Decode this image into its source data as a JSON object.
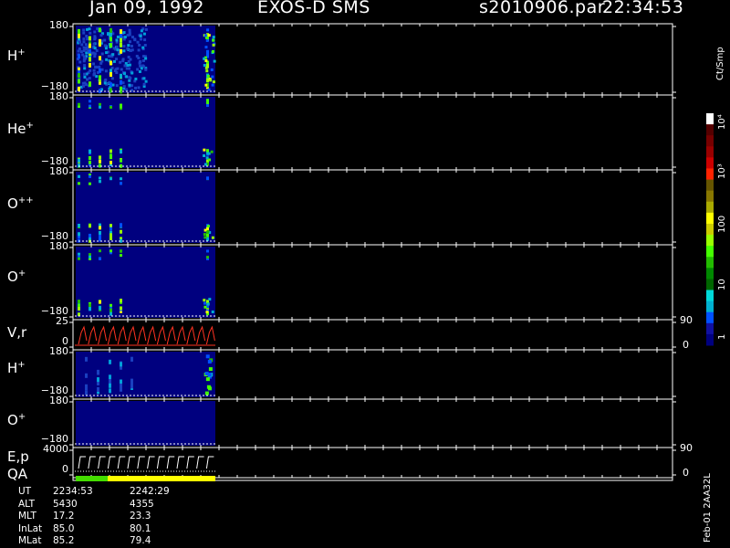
{
  "header": {
    "date": "Jan 09, 1992",
    "instrument": "EXOS-D SMS",
    "file": "s2010906.par",
    "time": "22:34:53"
  },
  "panels": [
    {
      "name": "H",
      "sup": "+",
      "top": "180",
      "bottom": "−180"
    },
    {
      "name": "He",
      "sup": "+",
      "top": "180",
      "bottom": "−180"
    },
    {
      "name": "O",
      "sup": "++",
      "top": "180",
      "bottom": "−180"
    },
    {
      "name": "O",
      "sup": "+",
      "top": "180",
      "bottom": "−180"
    },
    {
      "name": "V,r",
      "sup": "",
      "top": "25",
      "bottom": "0",
      "right_top": "90",
      "right_bottom": "0"
    },
    {
      "name": "H",
      "sup": "+",
      "top": "180",
      "bottom": "−180"
    },
    {
      "name": "O",
      "sup": "+",
      "top": "180",
      "bottom": "−180"
    },
    {
      "name": "E,p",
      "sup": "",
      "top": "4000",
      "bottom": "0",
      "right_top": "90",
      "right_bottom": "0"
    }
  ],
  "qa_label": "QA",
  "orbit": {
    "rows": [
      {
        "label": "UT",
        "v1": "2234:53",
        "v2": "2242:29"
      },
      {
        "label": "ALT",
        "v1": "5430",
        "v2": "4355"
      },
      {
        "label": "MLT",
        "v1": "17.2",
        "v2": "23.3"
      },
      {
        "label": "InLat",
        "v1": "85.0",
        "v2": "80.1"
      },
      {
        "label": "MLat",
        "v1": "85.2",
        "v2": "79.4"
      }
    ]
  },
  "colorbar": {
    "unit": "Ct/Smp",
    "labels": [
      "1",
      "10",
      "100",
      "10³",
      "10⁴"
    ],
    "colors": [
      "#00007f",
      "#1010a0",
      "#0050ff",
      "#00b0d0",
      "#00d8d8",
      "#006600",
      "#008800",
      "#22bb00",
      "#44ff00",
      "#99ff00",
      "#cccc00",
      "#ffff00",
      "#aaaa00",
      "#887700",
      "#665500",
      "#ff2200",
      "#cc0000",
      "#990000",
      "#770000",
      "#550000",
      "#ffffff"
    ],
    "colors_note": ""
  },
  "version": "Feb-01 2AA32L",
  "chart_data": {
    "type": "heatmap",
    "title": "Jan 09, 1992 EXOS-D SMS",
    "ylim": [
      -180,
      180
    ],
    "x_times": [
      "2234:53",
      "2242:29"
    ],
    "series": [
      {
        "name": "H+",
        "ylim": [
          -180,
          180
        ]
      },
      {
        "name": "He+",
        "ylim": [
          -180,
          180
        ]
      },
      {
        "name": "O++",
        "ylim": [
          -180,
          180
        ]
      },
      {
        "name": "O+",
        "ylim": [
          -180,
          180
        ]
      },
      {
        "name": "V,r",
        "ylim": [
          0,
          25
        ]
      },
      {
        "name": "H+",
        "ylim": [
          -180,
          180
        ]
      },
      {
        "name": "O+",
        "ylim": [
          -180,
          180
        ]
      },
      {
        "name": "E,p",
        "ylim": [
          0,
          4000
        ]
      }
    ],
    "colorscale_labels": [
      "1",
      "10",
      "100",
      "10³",
      "10⁴"
    ],
    "colorscale_unit": "Ct/Smp"
  }
}
